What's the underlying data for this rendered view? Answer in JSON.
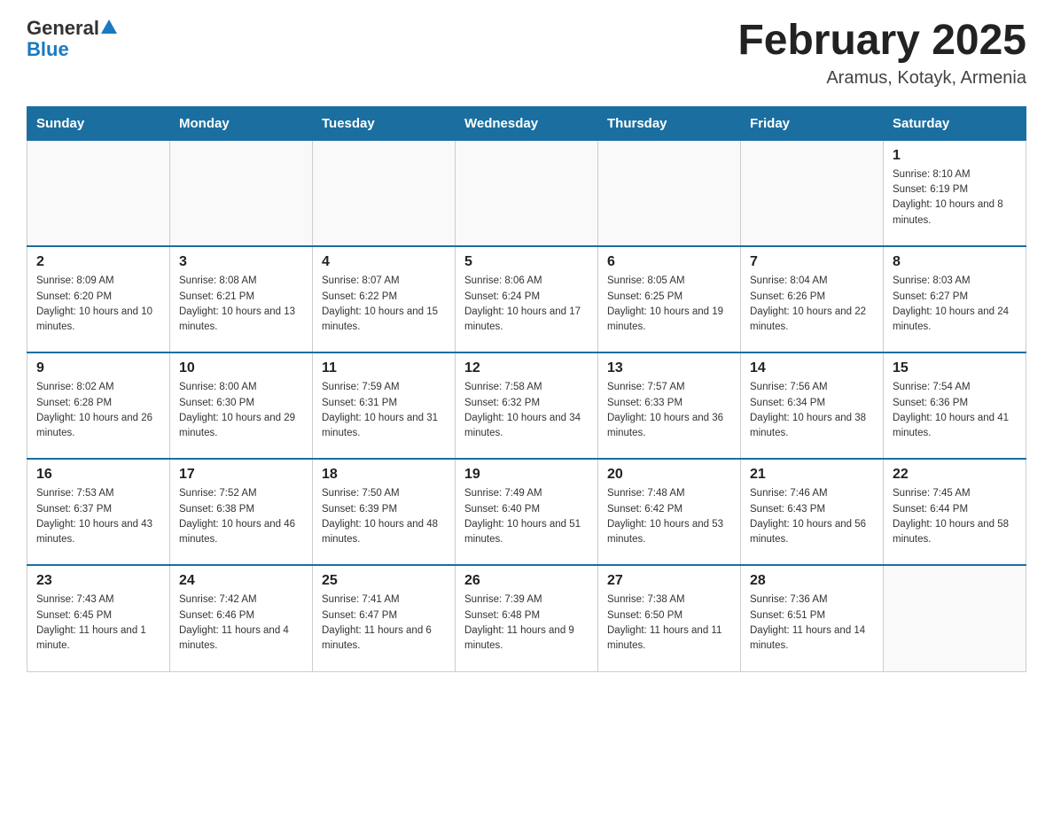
{
  "header": {
    "logo_general": "General",
    "logo_blue": "Blue",
    "title": "February 2025",
    "subtitle": "Aramus, Kotayk, Armenia"
  },
  "days_of_week": [
    "Sunday",
    "Monday",
    "Tuesday",
    "Wednesday",
    "Thursday",
    "Friday",
    "Saturday"
  ],
  "weeks": [
    [
      {
        "day": "",
        "info": ""
      },
      {
        "day": "",
        "info": ""
      },
      {
        "day": "",
        "info": ""
      },
      {
        "day": "",
        "info": ""
      },
      {
        "day": "",
        "info": ""
      },
      {
        "day": "",
        "info": ""
      },
      {
        "day": "1",
        "info": "Sunrise: 8:10 AM\nSunset: 6:19 PM\nDaylight: 10 hours and 8 minutes."
      }
    ],
    [
      {
        "day": "2",
        "info": "Sunrise: 8:09 AM\nSunset: 6:20 PM\nDaylight: 10 hours and 10 minutes."
      },
      {
        "day": "3",
        "info": "Sunrise: 8:08 AM\nSunset: 6:21 PM\nDaylight: 10 hours and 13 minutes."
      },
      {
        "day": "4",
        "info": "Sunrise: 8:07 AM\nSunset: 6:22 PM\nDaylight: 10 hours and 15 minutes."
      },
      {
        "day": "5",
        "info": "Sunrise: 8:06 AM\nSunset: 6:24 PM\nDaylight: 10 hours and 17 minutes."
      },
      {
        "day": "6",
        "info": "Sunrise: 8:05 AM\nSunset: 6:25 PM\nDaylight: 10 hours and 19 minutes."
      },
      {
        "day": "7",
        "info": "Sunrise: 8:04 AM\nSunset: 6:26 PM\nDaylight: 10 hours and 22 minutes."
      },
      {
        "day": "8",
        "info": "Sunrise: 8:03 AM\nSunset: 6:27 PM\nDaylight: 10 hours and 24 minutes."
      }
    ],
    [
      {
        "day": "9",
        "info": "Sunrise: 8:02 AM\nSunset: 6:28 PM\nDaylight: 10 hours and 26 minutes."
      },
      {
        "day": "10",
        "info": "Sunrise: 8:00 AM\nSunset: 6:30 PM\nDaylight: 10 hours and 29 minutes."
      },
      {
        "day": "11",
        "info": "Sunrise: 7:59 AM\nSunset: 6:31 PM\nDaylight: 10 hours and 31 minutes."
      },
      {
        "day": "12",
        "info": "Sunrise: 7:58 AM\nSunset: 6:32 PM\nDaylight: 10 hours and 34 minutes."
      },
      {
        "day": "13",
        "info": "Sunrise: 7:57 AM\nSunset: 6:33 PM\nDaylight: 10 hours and 36 minutes."
      },
      {
        "day": "14",
        "info": "Sunrise: 7:56 AM\nSunset: 6:34 PM\nDaylight: 10 hours and 38 minutes."
      },
      {
        "day": "15",
        "info": "Sunrise: 7:54 AM\nSunset: 6:36 PM\nDaylight: 10 hours and 41 minutes."
      }
    ],
    [
      {
        "day": "16",
        "info": "Sunrise: 7:53 AM\nSunset: 6:37 PM\nDaylight: 10 hours and 43 minutes."
      },
      {
        "day": "17",
        "info": "Sunrise: 7:52 AM\nSunset: 6:38 PM\nDaylight: 10 hours and 46 minutes."
      },
      {
        "day": "18",
        "info": "Sunrise: 7:50 AM\nSunset: 6:39 PM\nDaylight: 10 hours and 48 minutes."
      },
      {
        "day": "19",
        "info": "Sunrise: 7:49 AM\nSunset: 6:40 PM\nDaylight: 10 hours and 51 minutes."
      },
      {
        "day": "20",
        "info": "Sunrise: 7:48 AM\nSunset: 6:42 PM\nDaylight: 10 hours and 53 minutes."
      },
      {
        "day": "21",
        "info": "Sunrise: 7:46 AM\nSunset: 6:43 PM\nDaylight: 10 hours and 56 minutes."
      },
      {
        "day": "22",
        "info": "Sunrise: 7:45 AM\nSunset: 6:44 PM\nDaylight: 10 hours and 58 minutes."
      }
    ],
    [
      {
        "day": "23",
        "info": "Sunrise: 7:43 AM\nSunset: 6:45 PM\nDaylight: 11 hours and 1 minute."
      },
      {
        "day": "24",
        "info": "Sunrise: 7:42 AM\nSunset: 6:46 PM\nDaylight: 11 hours and 4 minutes."
      },
      {
        "day": "25",
        "info": "Sunrise: 7:41 AM\nSunset: 6:47 PM\nDaylight: 11 hours and 6 minutes."
      },
      {
        "day": "26",
        "info": "Sunrise: 7:39 AM\nSunset: 6:48 PM\nDaylight: 11 hours and 9 minutes."
      },
      {
        "day": "27",
        "info": "Sunrise: 7:38 AM\nSunset: 6:50 PM\nDaylight: 11 hours and 11 minutes."
      },
      {
        "day": "28",
        "info": "Sunrise: 7:36 AM\nSunset: 6:51 PM\nDaylight: 11 hours and 14 minutes."
      },
      {
        "day": "",
        "info": ""
      }
    ]
  ]
}
